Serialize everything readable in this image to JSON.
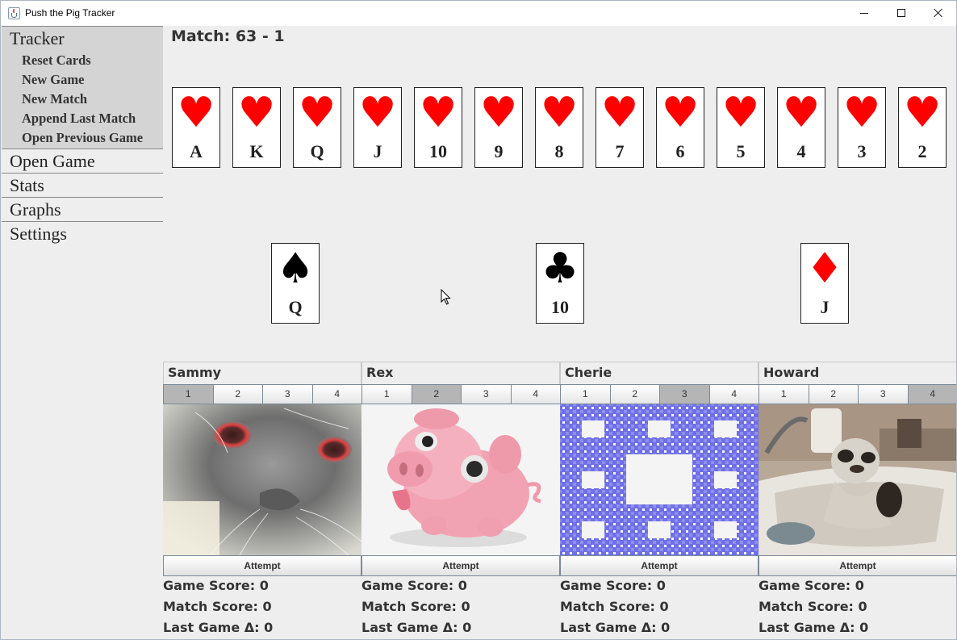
{
  "window": {
    "title": "Push the Pig Tracker"
  },
  "sidebar": {
    "tracker": {
      "label": "Tracker",
      "items": [
        "Reset Cards",
        "New Game",
        "New Match",
        "Append Last Match",
        "Open Previous Game"
      ]
    },
    "sections": [
      "Open Game",
      "Stats",
      "Graphs",
      "Settings"
    ]
  },
  "match": {
    "label": "Match: 63 - 1"
  },
  "heart_row": {
    "suit": "hearts",
    "suit_color": "#ff0000",
    "ranks": [
      "A",
      "K",
      "Q",
      "J",
      "10",
      "9",
      "8",
      "7",
      "6",
      "5",
      "4",
      "3",
      "2"
    ]
  },
  "played_cards": [
    {
      "suit": "spades",
      "rank": "Q",
      "color": "#000000"
    },
    {
      "suit": "clubs",
      "rank": "10",
      "color": "#000000"
    },
    {
      "suit": "diamonds",
      "rank": "J",
      "color": "#ff0000"
    }
  ],
  "players": [
    {
      "name": "Sammy",
      "tabs": [
        "1",
        "2",
        "3",
        "4"
      ],
      "selected_tab": "1",
      "avatar": "glowing-cat-image",
      "attempt_label": "Attempt",
      "game_score": "Game Score: 0",
      "match_score": "Match Score: 0",
      "last_game_delta": "Last Game Δ: 0"
    },
    {
      "name": "Rex",
      "tabs": [
        "1",
        "2",
        "3",
        "4"
      ],
      "selected_tab": "2",
      "avatar": "pink-pig-image",
      "attempt_label": "Attempt",
      "game_score": "Game Score: 0",
      "match_score": "Match Score: 0",
      "last_game_delta": "Last Game Δ: 0"
    },
    {
      "name": "Cherie",
      "tabs": [
        "1",
        "2",
        "3",
        "4"
      ],
      "selected_tab": "3",
      "avatar": "fractal-carpet-image",
      "attempt_label": "Attempt",
      "game_score": "Game Score: 0",
      "match_score": "Match Score: 0",
      "last_game_delta": "Last Game Δ: 0"
    },
    {
      "name": "Howard",
      "tabs": [
        "1",
        "2",
        "3",
        "4"
      ],
      "selected_tab": "4",
      "avatar": "cat-in-sink-image",
      "attempt_label": "Attempt",
      "game_score": "Game Score: 0",
      "match_score": "Match Score: 0",
      "last_game_delta": "Last Game Δ: 0"
    }
  ]
}
